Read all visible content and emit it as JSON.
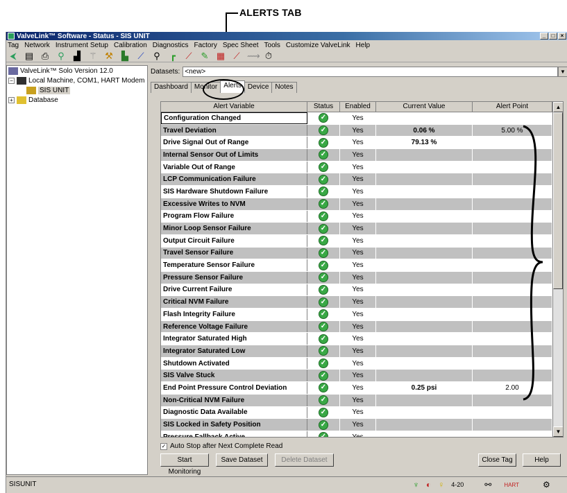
{
  "callout": {
    "label": "ALERTS TAB"
  },
  "window": {
    "title": "ValveLink™ Software - Status - SIS UNIT"
  },
  "menu": [
    "Tag",
    "Network",
    "Instrument Setup",
    "Calibration",
    "Diagnostics",
    "Factory",
    "Spec Sheet",
    "Tools",
    "Customize ValveLink",
    "Help"
  ],
  "toolbar_icons": [
    "open-icon",
    "new-icon",
    "print-icon",
    "network-icon",
    "device-icon",
    "antenna-icon",
    "setup-icon",
    "building-icon",
    "probe-icon",
    "search-icon",
    "step-icon",
    "calibrate-icon",
    "tune-icon",
    "chart-icon",
    "ramp-icon",
    "signature-icon",
    "timer-icon"
  ],
  "tree": {
    "root": "ValveLink™ Solo Version 12.0",
    "machine": "Local Machine, COM1, HART Modem",
    "unit": "SIS UNIT",
    "database": "Database"
  },
  "datasets": {
    "label": "Datasets:",
    "value": "<new>"
  },
  "tabs": [
    "Dashboard",
    "Monitor",
    "Alerts",
    "Device",
    "Notes"
  ],
  "table": {
    "headers": [
      "Alert Variable",
      "Status",
      "Enabled",
      "Current Value",
      "Alert Point"
    ],
    "rows": [
      {
        "name": "Configuration Changed",
        "enabled": "Yes",
        "current": "",
        "point": ""
      },
      {
        "name": "Travel Deviation",
        "enabled": "Yes",
        "current": "0.06 %",
        "point": "5.00 %"
      },
      {
        "name": "Drive Signal Out of Range",
        "enabled": "Yes",
        "current": "79.13 %",
        "point": ""
      },
      {
        "name": "Internal Sensor Out of Limits",
        "enabled": "Yes",
        "current": "",
        "point": ""
      },
      {
        "name": "Variable Out of Range",
        "enabled": "Yes",
        "current": "",
        "point": ""
      },
      {
        "name": "LCP Communication Failure",
        "enabled": "Yes",
        "current": "",
        "point": ""
      },
      {
        "name": "SIS Hardware Shutdown Failure",
        "enabled": "Yes",
        "current": "",
        "point": ""
      },
      {
        "name": "Excessive Writes to NVM",
        "enabled": "Yes",
        "current": "",
        "point": ""
      },
      {
        "name": "Program Flow Failure",
        "enabled": "Yes",
        "current": "",
        "point": ""
      },
      {
        "name": "Minor Loop Sensor Failure",
        "enabled": "Yes",
        "current": "",
        "point": ""
      },
      {
        "name": "Output Circuit Failure",
        "enabled": "Yes",
        "current": "",
        "point": ""
      },
      {
        "name": "Travel Sensor Failure",
        "enabled": "Yes",
        "current": "",
        "point": ""
      },
      {
        "name": "Temperature Sensor Failure",
        "enabled": "Yes",
        "current": "",
        "point": ""
      },
      {
        "name": "Pressure Sensor Failure",
        "enabled": "Yes",
        "current": "",
        "point": ""
      },
      {
        "name": "Drive Current Failure",
        "enabled": "Yes",
        "current": "",
        "point": ""
      },
      {
        "name": "Critical NVM Failure",
        "enabled": "Yes",
        "current": "",
        "point": ""
      },
      {
        "name": "Flash Integrity Failure",
        "enabled": "Yes",
        "current": "",
        "point": ""
      },
      {
        "name": "Reference Voltage Failure",
        "enabled": "Yes",
        "current": "",
        "point": ""
      },
      {
        "name": "Integrator Saturated High",
        "enabled": "Yes",
        "current": "",
        "point": ""
      },
      {
        "name": "Integrator Saturated Low",
        "enabled": "Yes",
        "current": "",
        "point": ""
      },
      {
        "name": "Shutdown Activated",
        "enabled": "Yes",
        "current": "",
        "point": ""
      },
      {
        "name": "SIS Valve Stuck",
        "enabled": "Yes",
        "current": "",
        "point": ""
      },
      {
        "name": "End Point Pressure Control Deviation",
        "enabled": "Yes",
        "current": "0.25 psi",
        "point": "2.00"
      },
      {
        "name": "Non-Critical NVM Failure",
        "enabled": "Yes",
        "current": "",
        "point": ""
      },
      {
        "name": "Diagnostic Data Available",
        "enabled": "Yes",
        "current": "",
        "point": ""
      },
      {
        "name": "SIS Locked in Safety Position",
        "enabled": "Yes",
        "current": "",
        "point": ""
      },
      {
        "name": "Pressure Fallback Active",
        "enabled": "Yes",
        "current": "",
        "point": ""
      }
    ]
  },
  "autostop": {
    "label": "Auto Stop after Next Complete Read",
    "checked": true
  },
  "buttons": {
    "start": "Start Monitoring",
    "save": "Save Dataset",
    "delete": "Delete Dataset",
    "close": "Close Tag",
    "help": "Help"
  },
  "status": {
    "text": "SISUNIT",
    "loop": "4-20",
    "hart": "HART"
  }
}
